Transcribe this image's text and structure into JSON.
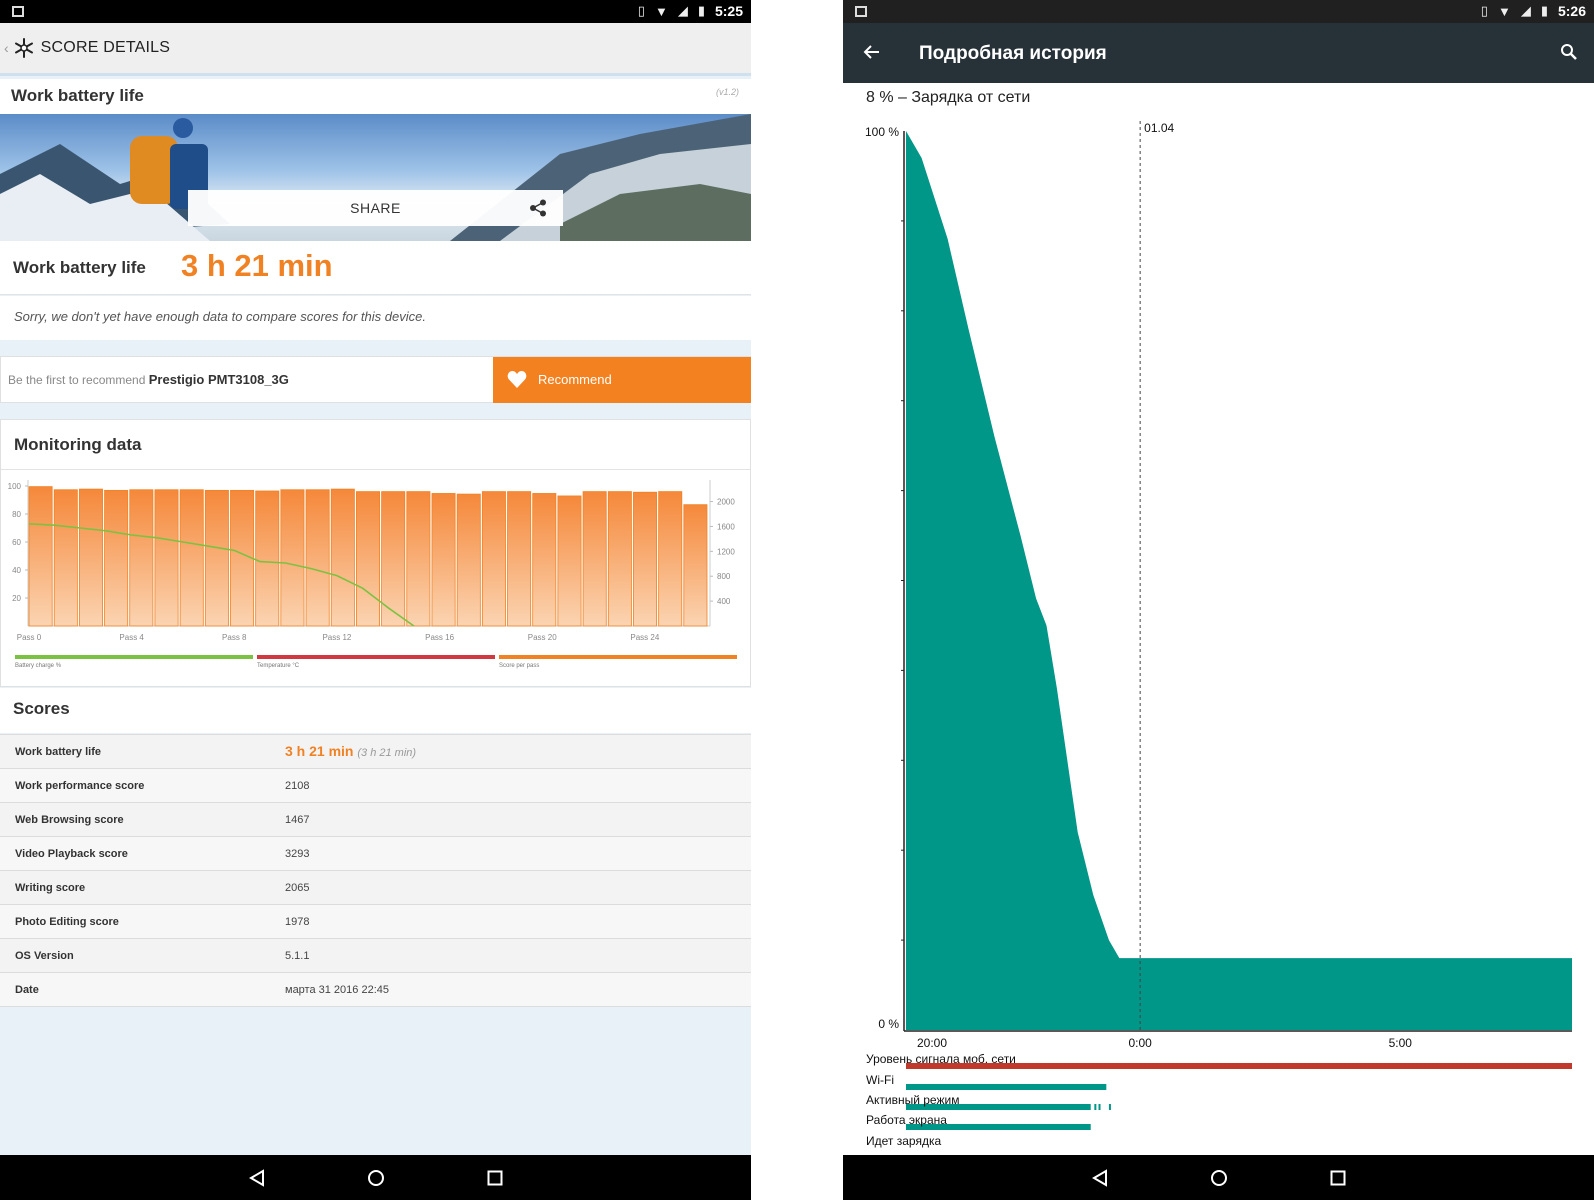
{
  "left_screen": {
    "status_time": "5:25",
    "header_title": "SCORE DETAILS",
    "test_title": "Work battery life",
    "version": "(v1.2)",
    "share_label": "SHARE",
    "score_label": "Work battery life",
    "score_value": "3 h 21 min",
    "sorry_text": "Sorry, we don't yet have enough data to compare scores for this device.",
    "recommend_prefix": "Be the first to recommend",
    "device_name": "Prestigio PMT3108_3G",
    "recommend_button": "Recommend",
    "monitoring_title": "Monitoring data",
    "scores_title": "Scores",
    "scores": [
      {
        "name": "Work battery life",
        "value": "3 h 21 min",
        "note": "(3 h 21 min)"
      },
      {
        "name": "Work performance score",
        "value": "2108"
      },
      {
        "name": "Web Browsing score",
        "value": "1467"
      },
      {
        "name": "Video Playback score",
        "value": "3293"
      },
      {
        "name": "Writing score",
        "value": "2065"
      },
      {
        "name": "Photo Editing score",
        "value": "1978"
      },
      {
        "name": "OS Version",
        "value": "5.1.1"
      },
      {
        "name": "Date",
        "value": "марта 31 2016 22:45"
      }
    ]
  },
  "right_screen": {
    "status_time": "5:26",
    "toolbar_title": "Подробная история",
    "subtitle": "8 % – Зарядка от сети",
    "y_top_label": "100 %",
    "y_bottom_label": "0 %",
    "marker_label": "01.04",
    "x_ticks": [
      "20:00",
      "0:00",
      "5:00"
    ],
    "status_rows": [
      "Уровень сигнала моб. сети",
      "Wi-Fi",
      "Активный режим",
      "Работа экрана",
      "Идет зарядка"
    ]
  },
  "colors": {
    "accent_orange": "#f08224",
    "battery_green": "#7cc242",
    "temp_red": "#d0393f",
    "history_teal": "#009688",
    "signal_red": "#c0392b"
  },
  "chart_data": [
    {
      "type": "bar",
      "title": "Monitoring data",
      "categories": [
        "Pass 0",
        "Pass 1",
        "Pass 2",
        "Pass 3",
        "Pass 4",
        "Pass 5",
        "Pass 6",
        "Pass 7",
        "Pass 8",
        "Pass 9",
        "Pass 10",
        "Pass 11",
        "Pass 12",
        "Pass 13",
        "Pass 14",
        "Pass 15",
        "Pass 16",
        "Pass 17",
        "Pass 18",
        "Pass 19",
        "Pass 20",
        "Pass 21",
        "Pass 22",
        "Pass 23",
        "Pass 24"
      ],
      "x_tick_labels": [
        "Pass 0",
        "Pass 4",
        "Pass 8",
        "Pass 12",
        "Pass 16",
        "Pass 20",
        "Pass 24"
      ],
      "left_ticks": [
        "100",
        "80",
        "60",
        "40",
        "20"
      ],
      "right_ticks": [
        "2000",
        "1600",
        "1200",
        "800",
        "400"
      ],
      "legend": [
        "Battery charge %",
        "Temperature °C",
        "Score per pass"
      ],
      "series": [
        {
          "name": "Score per pass",
          "axis": "right",
          "values": [
            2240,
            2190,
            2200,
            2180,
            2190,
            2190,
            2190,
            2180,
            2180,
            2170,
            2190,
            2190,
            2200,
            2160,
            2160,
            2160,
            2130,
            2120,
            2160,
            2160,
            2130,
            2090,
            2160,
            2160,
            2150,
            2160,
            1950
          ]
        },
        {
          "name": "Battery charge %",
          "axis": "left",
          "x": [
            0,
            1,
            2,
            3,
            4,
            5,
            6,
            7,
            8,
            9,
            10,
            11,
            12,
            13,
            14,
            15,
            16
          ],
          "values": [
            73,
            72,
            70,
            68,
            65,
            63,
            60,
            57,
            54,
            46,
            45,
            41,
            36,
            27,
            13,
            0,
            null
          ]
        }
      ],
      "ylim_left": [
        0,
        100
      ],
      "ylim_right": [
        0,
        2250
      ]
    },
    {
      "type": "area",
      "title": "",
      "x_ticks": [
        "20:00",
        "0:00",
        "5:00"
      ],
      "ylim": [
        0,
        100
      ],
      "x_hours_from_1930": [
        0,
        0.3,
        0.8,
        1.2,
        1.7,
        2.2,
        2.5,
        2.7,
        2.9,
        3.1,
        3.3,
        3.6,
        3.9,
        4.1,
        4.5,
        6,
        8,
        10,
        12,
        12.8
      ],
      "values": [
        100,
        97,
        88,
        78,
        66,
        55,
        48,
        45,
        38,
        30,
        22,
        15,
        10,
        8,
        8,
        8,
        8,
        8,
        8,
        8
      ]
    }
  ]
}
